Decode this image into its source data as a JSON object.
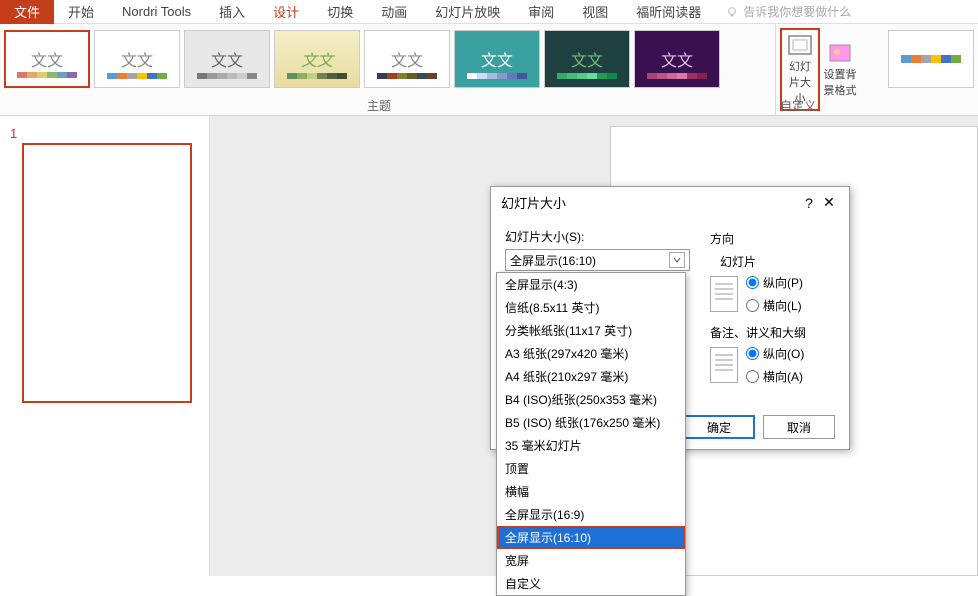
{
  "tabs": {
    "file": "文件",
    "home": "开始",
    "nordri": "Nordri Tools",
    "insert": "插入",
    "design": "设计",
    "transition": "切换",
    "animation": "动画",
    "slideshow": "幻灯片放映",
    "review": "审阅",
    "view": "视图",
    "foxit": "福昕阅读器",
    "tellme": "告诉我你想要做什么"
  },
  "ribbon": {
    "theme_text": "文文",
    "themes_label": "主题",
    "custom_label": "自定义",
    "slide_size": "幻灯片大小",
    "background": "设置背景格式"
  },
  "slide": {
    "num": "1"
  },
  "dialog": {
    "title": "幻灯片大小",
    "help": "?",
    "close": "✕",
    "size_label": "幻灯片大小(S):",
    "size_value": "全屏显示(16:10)",
    "direction_label": "方向",
    "slide_section": "幻灯片",
    "portrait_p": "纵向(P)",
    "landscape_l": "横向(L)",
    "notes_section": "备注、讲义和大纲",
    "portrait_o": "纵向(O)",
    "landscape_a": "横向(A)",
    "ok": "确定",
    "cancel": "取消"
  },
  "dropdown": {
    "options": [
      "全屏显示(4:3)",
      "信纸(8.5x11 英寸)",
      "分类帐纸张(11x17 英寸)",
      "A3 纸张(297x420 毫米)",
      "A4 纸张(210x297 毫米)",
      "B4 (ISO)纸张(250x353 毫米)",
      "B5 (ISO) 纸张(176x250 毫米)",
      "35 毫米幻灯片",
      "顶置",
      "横幅",
      "全屏显示(16:9)",
      "全屏显示(16:10)",
      "宽屏",
      "自定义"
    ],
    "selected_index": 11
  }
}
